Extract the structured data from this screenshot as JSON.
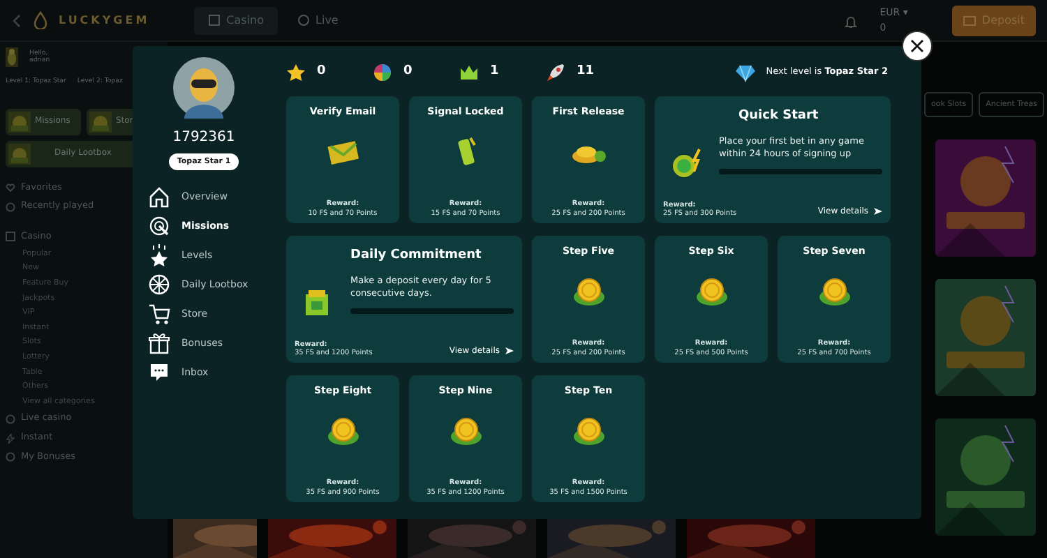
{
  "topbar": {
    "logo": "LUCKYGEM",
    "tabs": [
      {
        "label": "Casino",
        "selected": true
      },
      {
        "label": "Live",
        "selected": false
      }
    ],
    "currency": "EUR ▾",
    "balance": "0",
    "deposit": "Deposit"
  },
  "sidebar": {
    "greeting": "Hello,",
    "username": "adrian",
    "levels": [
      "Level 1: Topaz Star",
      "Level 2: Topaz"
    ],
    "promos": [
      "Missions",
      "Stor",
      "Daily Lootbox"
    ],
    "links": [
      "Favorites",
      "Recently played"
    ],
    "section": "Casino",
    "categories": [
      "Popular",
      "New",
      "Feature Buy",
      "Jackpots",
      "VIP",
      "Instant",
      "Slots",
      "Lottery",
      "Table",
      "Others",
      "View all categories"
    ],
    "more_links": [
      "Live casino",
      "Instant",
      "My Bonuses"
    ]
  },
  "chips": [
    "ook Slots",
    "Ancient Treas"
  ],
  "modal": {
    "user_id": "1792361",
    "rank": "Topaz Star 1",
    "menu": [
      {
        "label": "Overview",
        "selected": false
      },
      {
        "label": "Missions",
        "selected": true
      },
      {
        "label": "Levels",
        "selected": false
      },
      {
        "label": "Daily Lootbox",
        "selected": false
      },
      {
        "label": "Store",
        "selected": false
      },
      {
        "label": "Bonuses",
        "selected": false
      },
      {
        "label": "Inbox",
        "selected": false
      }
    ],
    "stats": [
      "0",
      "0",
      "1",
      "11"
    ],
    "next_level": "Next level is **Topaz Star 2**",
    "missions": [
      {
        "kind": "card",
        "title": "Verify Email",
        "reward_label": "Reward:",
        "reward": "10 FS and 70 Points"
      },
      {
        "kind": "card",
        "title": "Signal Locked",
        "reward_label": "Reward:",
        "reward": "15 FS and 70 Points"
      },
      {
        "kind": "card",
        "title": "First Release",
        "reward_label": "Reward:",
        "reward": "25 FS and 200 Points"
      },
      {
        "kind": "wide",
        "title": "Quick Start",
        "description": "Place your first bet in any game within 24 hours of signing up",
        "level": 0,
        "reward_label": "Reward:",
        "reward": "25 FS and 300 Points",
        "link": "View details"
      },
      {
        "kind": "wide",
        "title": "Daily Commitment",
        "description": "Make a deposit every day for 5 consecutive days.",
        "level": 0,
        "reward_label": "Reward:",
        "reward": "35 FS and 1200 Points",
        "link": "View details"
      },
      {
        "kind": "card",
        "title": "Step Five",
        "reward_label": "Reward:",
        "reward": "25 FS and 200 Points"
      },
      {
        "kind": "card",
        "title": "Step Six",
        "reward_label": "Reward:",
        "reward": "25 FS and 500 Points"
      },
      {
        "kind": "card",
        "title": "Step Seven",
        "reward_label": "Reward:",
        "reward": "25 FS and 700 Points"
      },
      {
        "kind": "card",
        "title": "Step Eight",
        "reward_label": "Reward:",
        "reward": "35 FS and 900 Points"
      },
      {
        "kind": "card",
        "title": "Step Nine",
        "reward_label": "Reward:",
        "reward": "35 FS and 1200 Points"
      },
      {
        "kind": "card",
        "title": "Step Ten",
        "reward_label": "Reward:",
        "reward": "35 FS and 1500 Points"
      }
    ]
  }
}
